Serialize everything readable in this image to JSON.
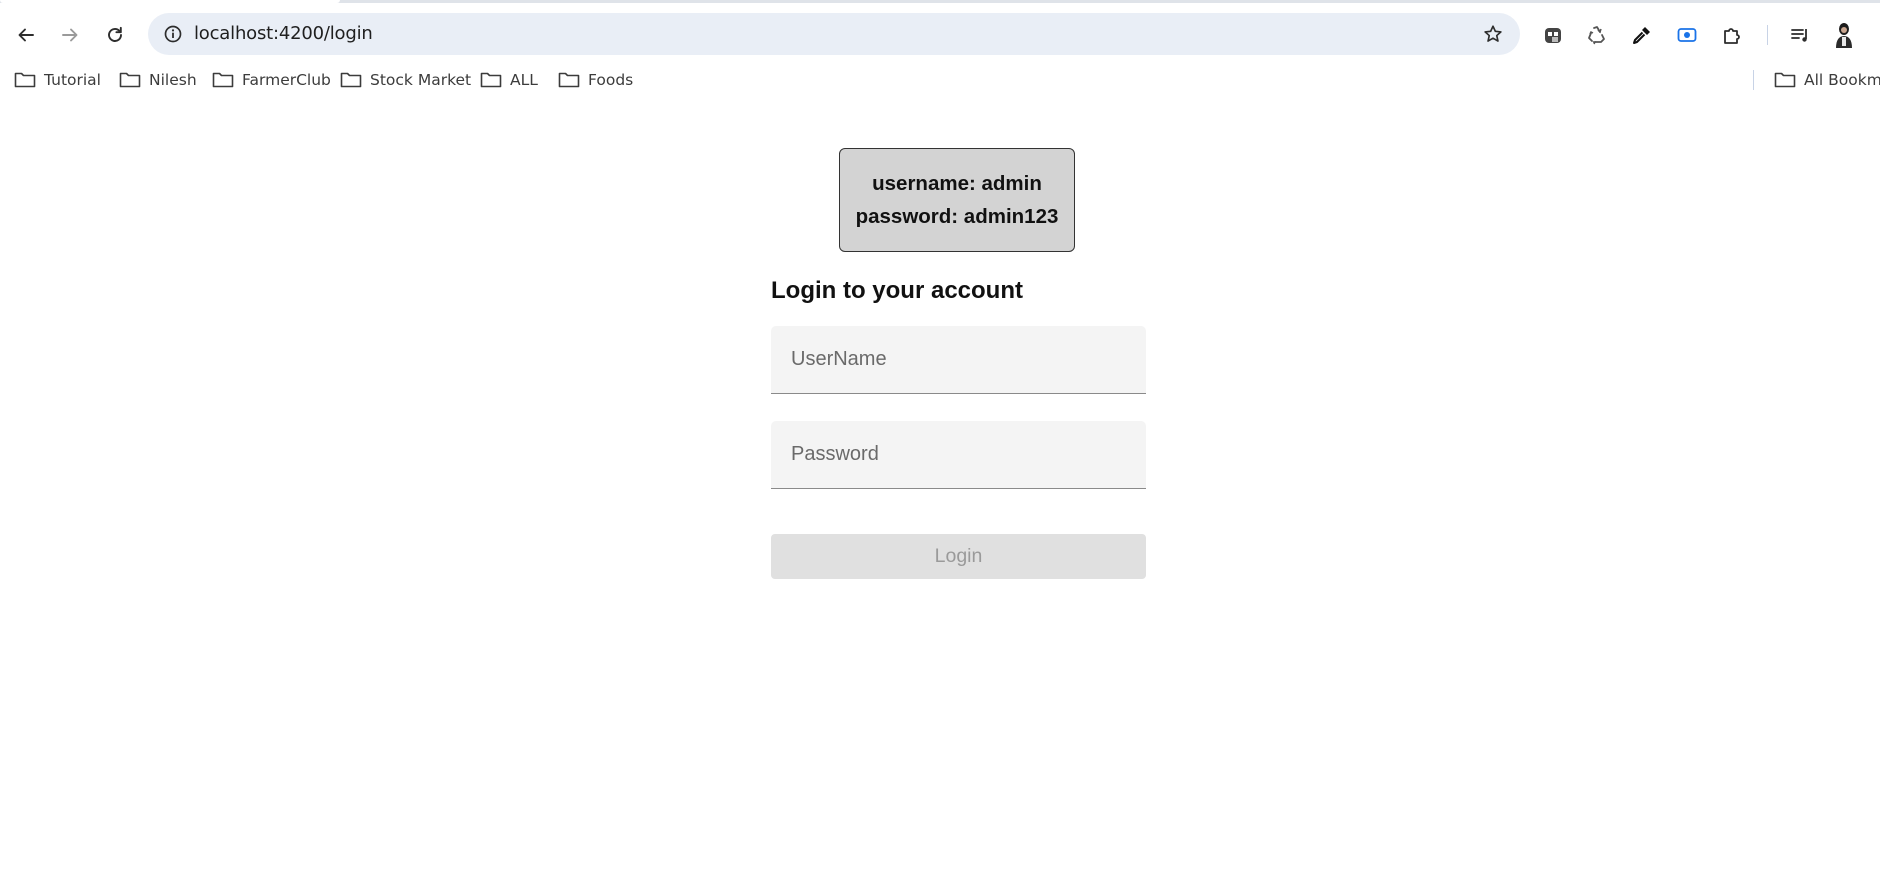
{
  "browser": {
    "url": "localhost:4200/login",
    "icons": {
      "back": "arrow-left-icon",
      "forward": "arrow-right-icon",
      "reload": "reload-icon",
      "site_info": "info-icon",
      "bookmark_star": "star-icon",
      "extensions": [
        "ghost-extension-icon",
        "recycle-extension-icon",
        "eyedropper-extension-icon",
        "screen-record-extension-icon",
        "puzzle-extensions-icon",
        "media-queue-icon",
        "profile-avatar-icon"
      ]
    }
  },
  "bookmarks": {
    "items": [
      {
        "label": "Tutorial"
      },
      {
        "label": "Nilesh"
      },
      {
        "label": "FarmerClub"
      },
      {
        "label": "Stock Market"
      },
      {
        "label": "ALL"
      },
      {
        "label": "Foods"
      }
    ],
    "all_bookmarks_label": "All Bookma"
  },
  "login": {
    "hint_username": "username: admin",
    "hint_password": "password: admin123",
    "heading": "Login to your account",
    "username_placeholder": "UserName",
    "password_placeholder": "Password",
    "username_value": "",
    "password_value": "",
    "submit_label": "Login",
    "submit_disabled": true
  },
  "colors": {
    "omnibox_bg": "#e9eef6",
    "hint_box_bg": "#d3d3d3",
    "field_bg": "#f4f4f4",
    "button_disabled_bg": "#e0e0e0",
    "button_disabled_text": "#9a9a9a",
    "record_icon_accent": "#1a73e8"
  }
}
